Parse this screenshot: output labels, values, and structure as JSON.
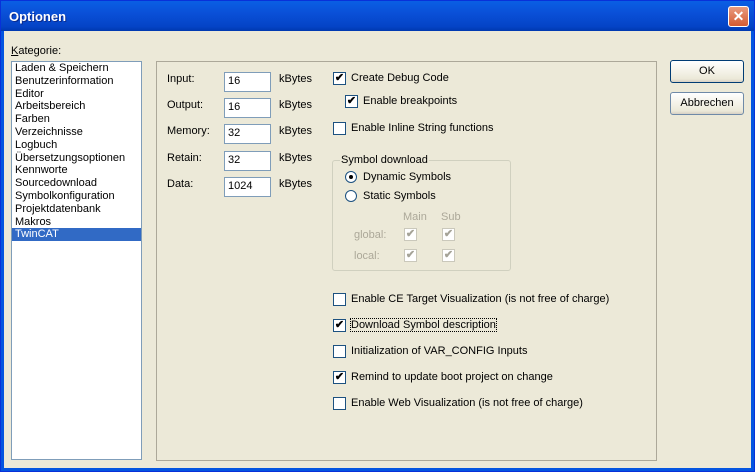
{
  "window": {
    "title": "Optionen",
    "close_glyph": "✕"
  },
  "category": {
    "label_prefix": "K",
    "label_rest": "ategorie:",
    "items": [
      "Laden & Speichern",
      "Benutzerinformation",
      "Editor",
      "Arbeitsbereich",
      "Farben",
      "Verzeichnisse",
      "Logbuch",
      "Übersetzungsoptionen",
      "Kennworte",
      "Sourcedownload",
      "Symbolkonfiguration",
      "Projektdatenbank",
      "Makros",
      "TwinCAT"
    ],
    "selected_index": 13
  },
  "memory_fields": [
    {
      "label": "Input:",
      "value": "16",
      "unit": "kBytes"
    },
    {
      "label": "Output:",
      "value": "16",
      "unit": "kBytes"
    },
    {
      "label": "Memory:",
      "value": "32",
      "unit": "kBytes"
    },
    {
      "label": "Retain:",
      "value": "32",
      "unit": "kBytes"
    },
    {
      "label": "Data:",
      "value": "1024",
      "unit": "kBytes"
    }
  ],
  "options": {
    "create_debug": {
      "label": "Create Debug Code",
      "checked": true
    },
    "enable_breakpoints": {
      "label": "Enable breakpoints",
      "checked": true
    },
    "inline_string": {
      "label": "Enable Inline String functions",
      "checked": false
    }
  },
  "symbol_download": {
    "title": "Symbol download",
    "dynamic": {
      "label": "Dynamic Symbols",
      "selected": true
    },
    "static": {
      "label": "Static Symbols",
      "selected": false
    },
    "col_main": "Main",
    "col_sub": "Sub",
    "row_global": "global:",
    "row_local": "local:"
  },
  "lower_options": [
    {
      "label": "Enable CE Target Visualization (is not free of charge)",
      "checked": false
    },
    {
      "label": "Download Symbol description",
      "checked": true
    },
    {
      "label": "Initialization of VAR_CONFIG Inputs",
      "checked": false
    },
    {
      "label": "Remind to update boot project on change",
      "checked": true
    },
    {
      "label": "Enable Web Visualization (is not free of charge)",
      "checked": false
    }
  ],
  "buttons": {
    "ok": "OK",
    "cancel": "Abbrechen"
  },
  "check_glyph": "✔"
}
